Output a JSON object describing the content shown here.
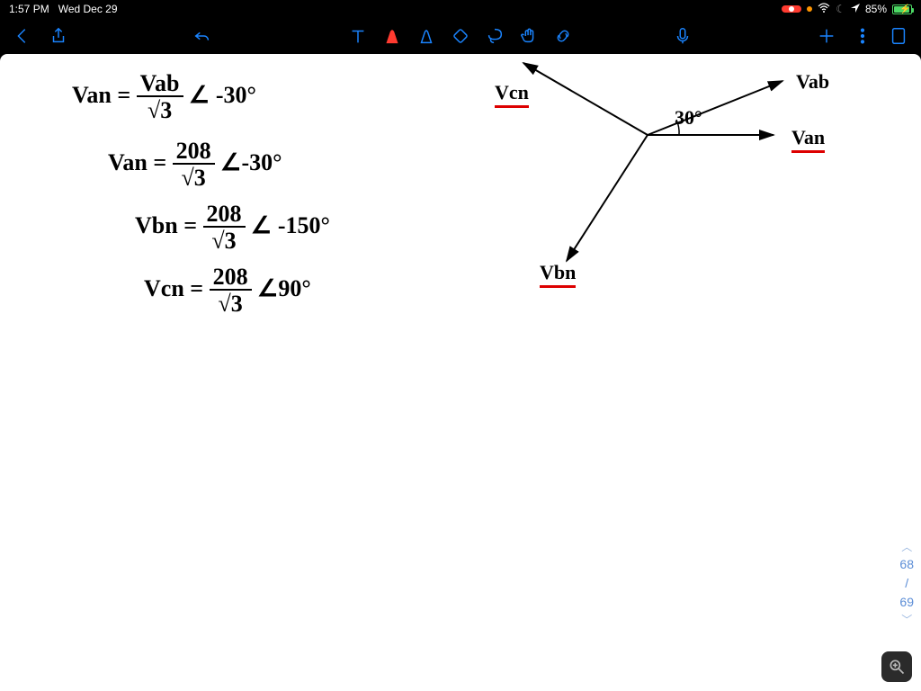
{
  "status": {
    "time": "1:57 PM",
    "date": "Wed Dec 29",
    "battery_pct": "85%"
  },
  "toolbar": {
    "back": "Back",
    "share": "Share",
    "undo": "Undo",
    "text_tool": "Text",
    "pen": "Pen",
    "pencil": "Pencil",
    "eraser": "Eraser",
    "lasso": "Lasso",
    "hand": "Hand",
    "link": "Link",
    "mic": "Microphone",
    "add": "Add",
    "more": "More",
    "pages": "Pages"
  },
  "pager": {
    "current": "68",
    "sep": "/",
    "total": "69"
  },
  "equations": {
    "e1_lhs": "Van =",
    "e1_num": "Vab",
    "e1_den": "√3",
    "e1_ang": "∠ -30°",
    "e2_lhs": "Van =",
    "e2_num": "208",
    "e2_den": "√3",
    "e2_ang": "∠-30°",
    "e3_lhs": "Vbn =",
    "e3_num": "208",
    "e3_den": "√3",
    "e3_ang": "∠ -150°",
    "e4_lhs": "Vcn =",
    "e4_num": "208",
    "e4_den": "√3",
    "e4_ang": "∠90°"
  },
  "diagram": {
    "vcn": "Vcn",
    "vbn": "Vbn",
    "van": "Van",
    "vab": "Vab",
    "angle": "30°"
  },
  "zoom": {
    "label": "Zoom"
  }
}
